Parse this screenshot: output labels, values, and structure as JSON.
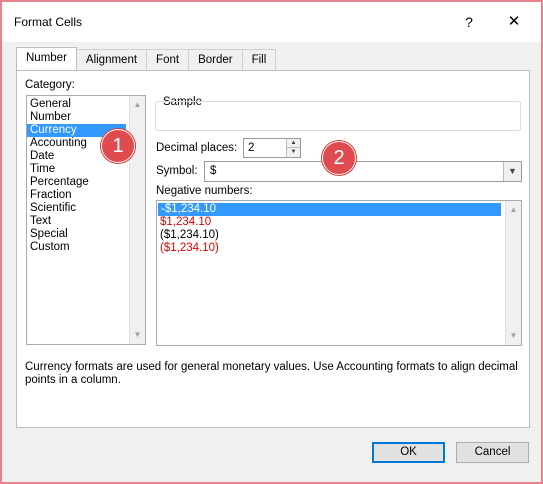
{
  "window": {
    "title": "Format Cells",
    "help_glyph": "?",
    "close_glyph": "✕"
  },
  "tabs": [
    "Number",
    "Alignment",
    "Font",
    "Border",
    "Fill"
  ],
  "category": {
    "label": "Category:",
    "items": [
      "General",
      "Number",
      "Currency",
      "Accounting",
      "Date",
      "Time",
      "Percentage",
      "Fraction",
      "Scientific",
      "Text",
      "Special",
      "Custom"
    ],
    "selected": "Currency"
  },
  "sample": {
    "label": "Sample",
    "value": ""
  },
  "decimal_places": {
    "label": "Decimal places:",
    "value": "2"
  },
  "symbol": {
    "label": "Symbol:",
    "value": "$"
  },
  "negative_numbers": {
    "label": "Negative numbers:",
    "items": [
      {
        "text": "-$1,234.10",
        "color": "#000000",
        "selected": true
      },
      {
        "text": "$1,234.10",
        "color": "#e00000",
        "selected": false
      },
      {
        "text": "($1,234.10)",
        "color": "#000000",
        "selected": false
      },
      {
        "text": "($1,234.10)",
        "color": "#e00000",
        "selected": false
      }
    ]
  },
  "description": "Currency formats are used for general monetary values.  Use Accounting formats to align decimal points in a column.",
  "buttons": {
    "ok": "OK",
    "cancel": "Cancel"
  },
  "annotations": {
    "badge1": "1",
    "badge2": "2"
  },
  "colors": {
    "selection": "#3399ff",
    "badge": "#e04b4f",
    "frame": "#e6838e",
    "negative_red": "#e00000"
  }
}
